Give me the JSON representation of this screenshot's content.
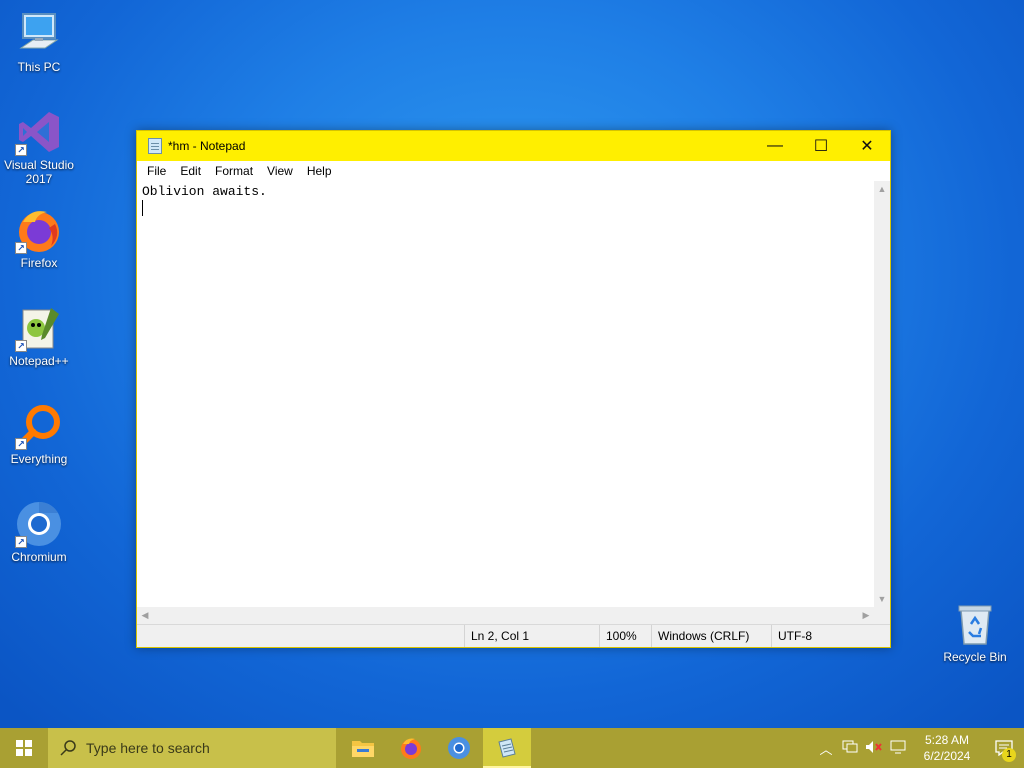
{
  "desktop": {
    "icons": [
      {
        "label": "This PC"
      },
      {
        "label": "Visual Studio 2017"
      },
      {
        "label": "Firefox"
      },
      {
        "label": "Notepad++"
      },
      {
        "label": "Everything"
      },
      {
        "label": "Chromium"
      },
      {
        "label": "Recycle Bin"
      }
    ]
  },
  "window": {
    "title": "*hm - Notepad",
    "minimize_glyph": "—",
    "maximize_glyph": "☐",
    "close_glyph": "✕",
    "menu": [
      "File",
      "Edit",
      "Format",
      "View",
      "Help"
    ],
    "content_line1": "Oblivion awaits.",
    "status": {
      "position": "Ln 2, Col 1",
      "zoom": "100%",
      "line_ending": "Windows (CRLF)",
      "encoding": "UTF-8"
    },
    "titlebar_color": "#ffef00"
  },
  "taskbar": {
    "search_placeholder": "Type here to search",
    "apps": [
      "file-explorer-icon",
      "firefox-icon",
      "chromium-icon",
      "notepad-icon"
    ],
    "time": "5:28 AM",
    "date": "6/2/2024",
    "notification_count": "1",
    "color": "#a9a033"
  }
}
